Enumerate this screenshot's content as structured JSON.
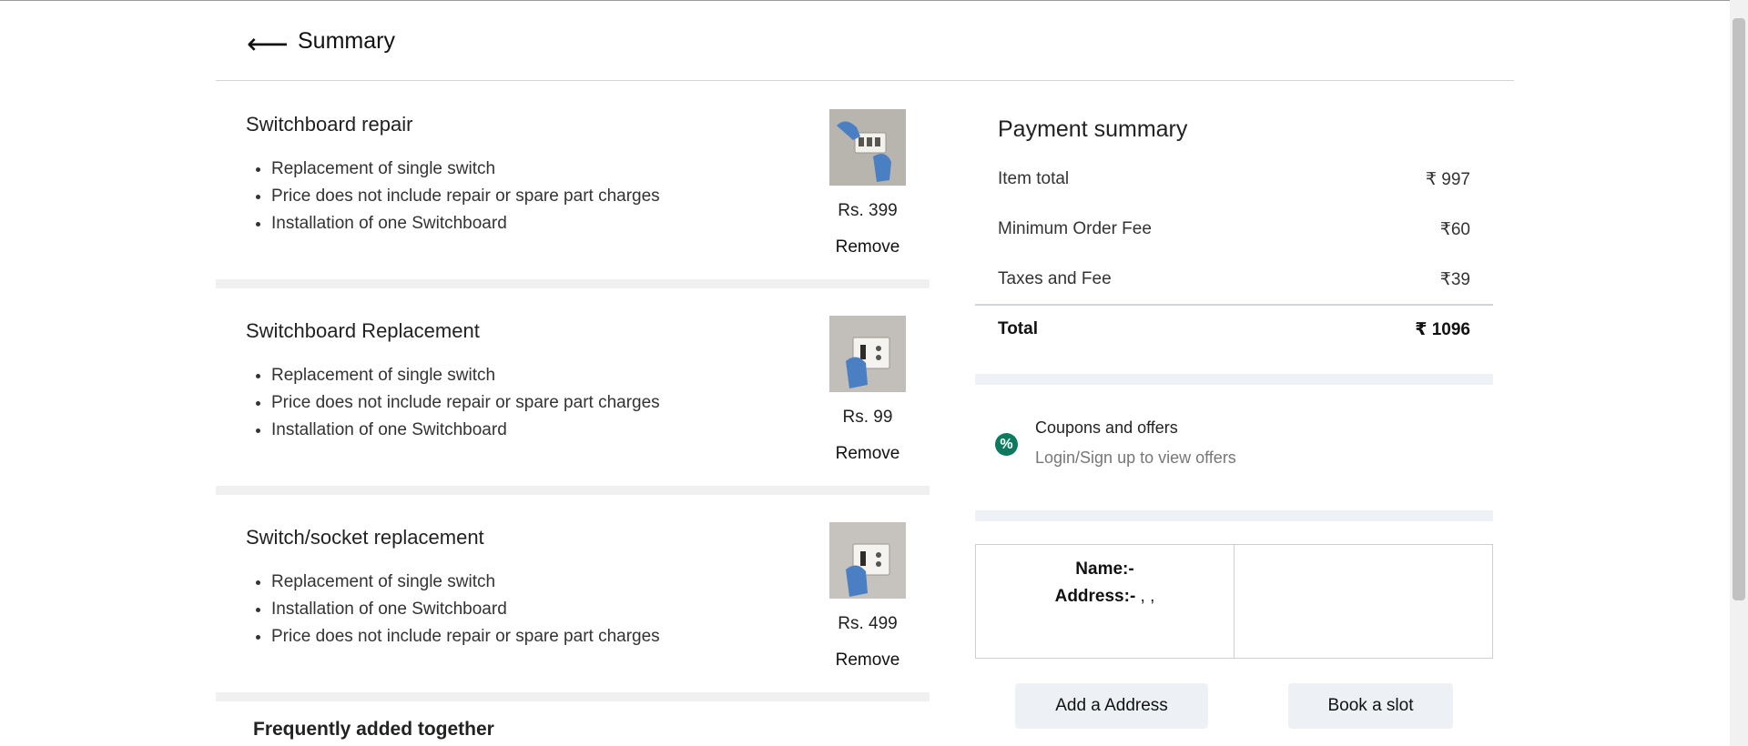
{
  "header": {
    "title": "Summary",
    "back_icon": "arrow-left-icon"
  },
  "services": [
    {
      "title": "Switchboard repair",
      "points": [
        "Replacement of single switch",
        "Price does not include repair or spare part charges",
        "Installation of one Switchboard"
      ],
      "price": "Rs. 399",
      "remove_label": "Remove"
    },
    {
      "title": "Switchboard Replacement",
      "points": [
        "Replacement of single switch",
        "Price does not include repair or spare part charges",
        "Installation of one Switchboard"
      ],
      "price": "Rs. 99",
      "remove_label": "Remove"
    },
    {
      "title": "Switch/socket replacement",
      "points": [
        "Replacement of single switch",
        "Installation of one Switchboard",
        "Price does not include repair or spare part charges"
      ],
      "price": "Rs. 499",
      "remove_label": "Remove"
    }
  ],
  "frequently_added_title": "Frequently added together",
  "payment": {
    "title": "Payment summary",
    "item_total_label": "Item total",
    "item_total_value": "₹ 997",
    "min_fee_label": "Minimum Order Fee",
    "min_fee_value": "₹60",
    "taxes_label": "Taxes and Fee",
    "taxes_value": "₹39",
    "total_label": "Total",
    "total_value": "₹ 1096"
  },
  "coupons": {
    "icon": "%",
    "title": "Coupons and offers",
    "subtitle": "Login/Sign up to view offers",
    "accent": "#0d7a5f"
  },
  "address": {
    "name_label": "Name:-",
    "name_value": "",
    "address_label": "Address:-",
    "address_value": " , ,"
  },
  "buttons": {
    "add_address": "Add a Address",
    "book_slot": "Book a slot"
  },
  "colors": {
    "band": "#eef2f6",
    "card_divider": "#f0f0f0",
    "button_bg": "#edf1f5"
  }
}
